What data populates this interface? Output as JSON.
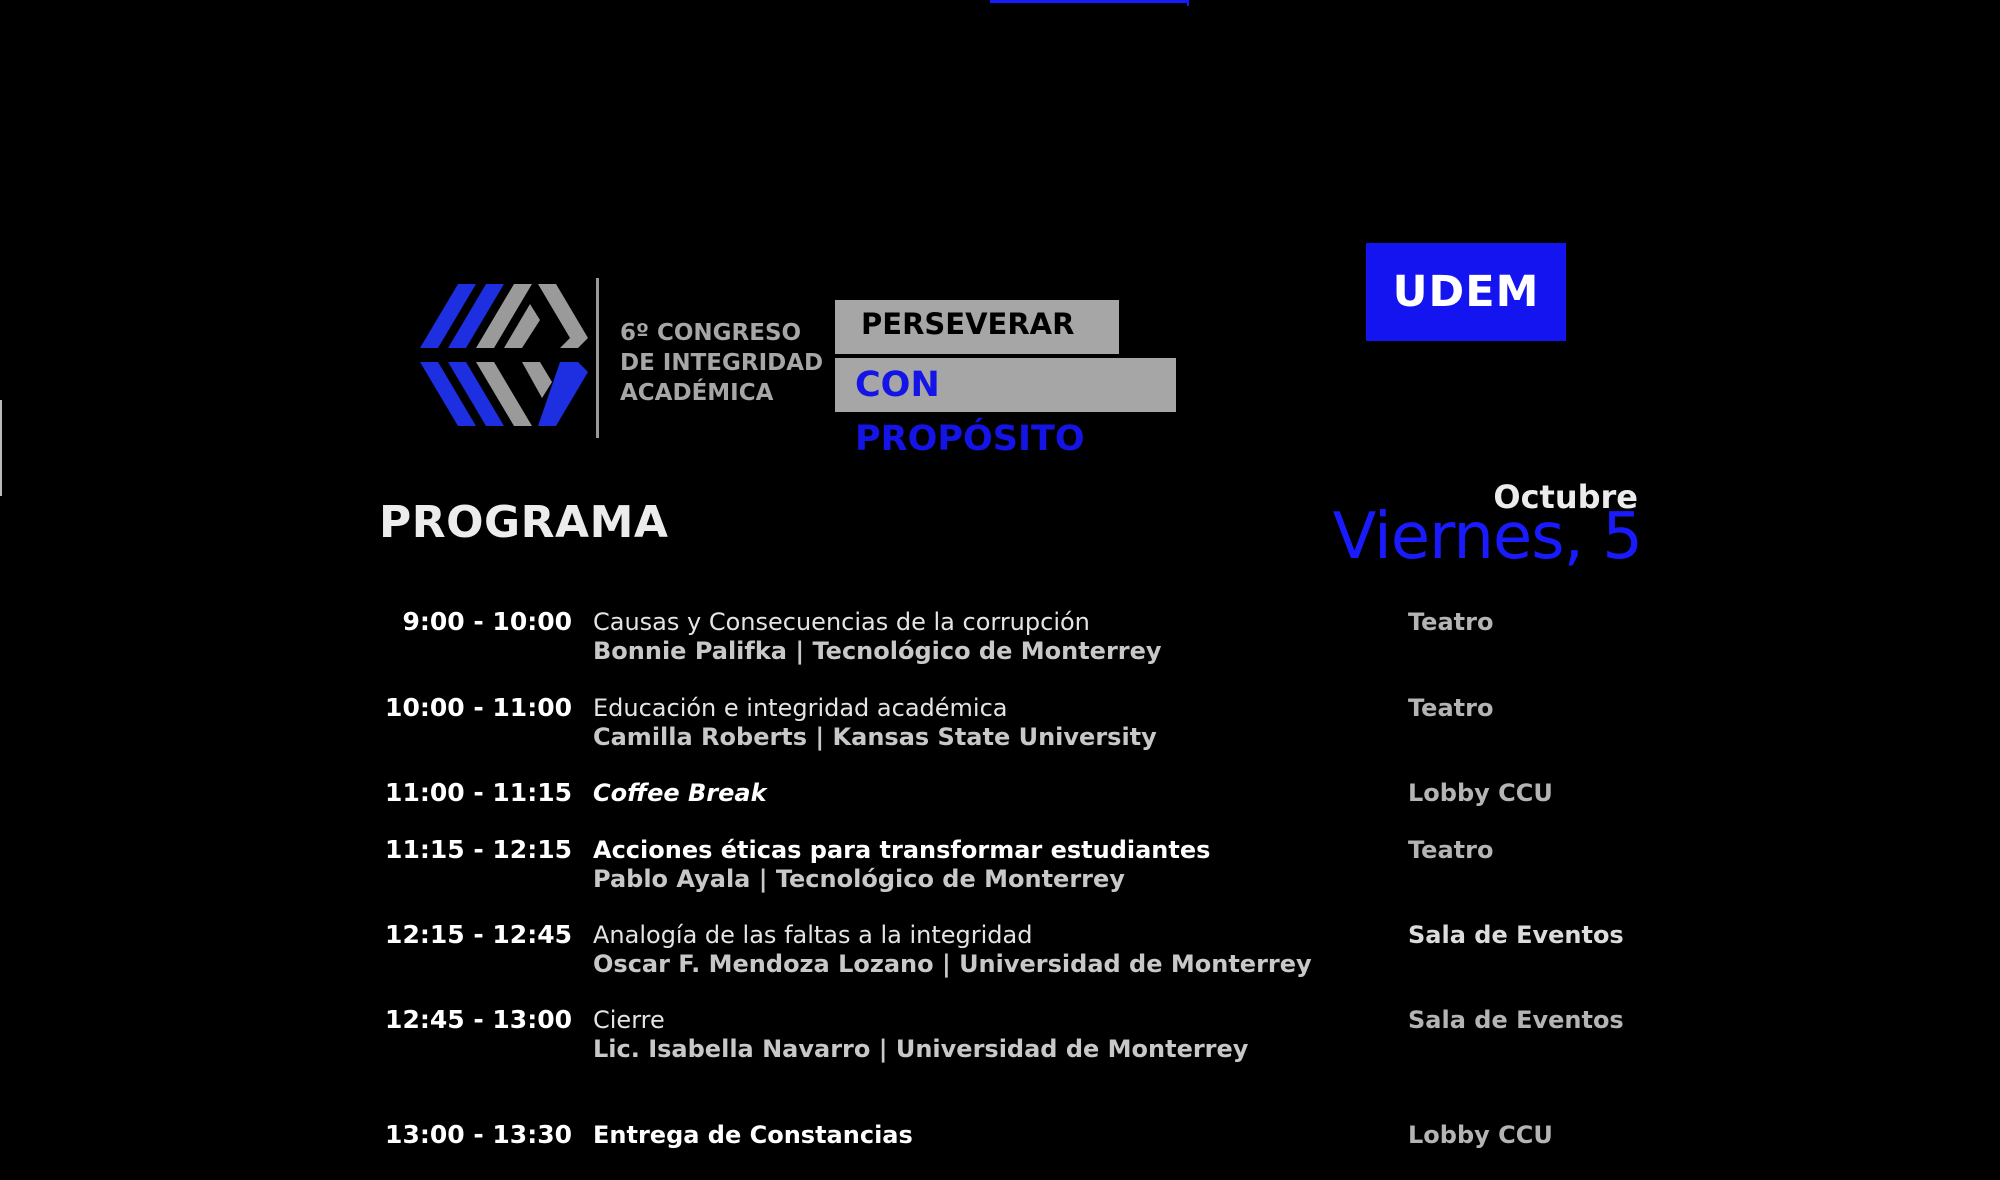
{
  "header": {
    "congress_title": "6º CONGRESO\nDE INTEGRIDAD\nACADÉMICA",
    "tag_line_1": "PERSEVERAR",
    "tag_line_2": "CON PROPÓSITO",
    "udem_logo_text": "UDEM"
  },
  "program": {
    "title": "PROGRAMA",
    "month": "Octubre",
    "day": "Viernes, 5"
  },
  "schedule": [
    {
      "time": "9:00 - 10:00",
      "title": "Causas y Consecuencias de la corrupción",
      "speaker": "Bonnie Palifka | Tecnológico de Monterrey",
      "venue": "Teatro"
    },
    {
      "time": "10:00 - 11:00",
      "title": "Educación e integridad académica",
      "speaker": "Camilla Roberts | Kansas State University",
      "venue": "Teatro"
    },
    {
      "time": "11:00 - 11:15",
      "title": "Coffee Break",
      "speaker": "",
      "venue": "Lobby CCU"
    },
    {
      "time": "11:15 - 12:15",
      "title": "Acciones éticas para transformar estudiantes",
      "speaker": "Pablo Ayala | Tecnológico de Monterrey",
      "venue": "Teatro"
    },
    {
      "time": "12:15 - 12:45",
      "title": "Analogía de las faltas a la integridad",
      "speaker": "Oscar F. Mendoza Lozano | Universidad de Monterrey",
      "venue": "Sala de Eventos"
    },
    {
      "time": "12:45 - 13:00",
      "title": "Cierre",
      "speaker": "Lic. Isabella Navarro | Universidad de Monterrey",
      "venue": "Sala de Eventos"
    },
    {
      "time": "13:00 - 13:30",
      "title": "Entrega de Constancias",
      "speaker": "",
      "venue": "Lobby CCU"
    }
  ],
  "colors": {
    "background": "#000000",
    "accent_blue": "#1414f0",
    "gray_box": "#a6a6a6",
    "logo_gray": "#9a9a9a"
  },
  "icons": {
    "congress_logo": "interlocking-chevron-logo"
  }
}
